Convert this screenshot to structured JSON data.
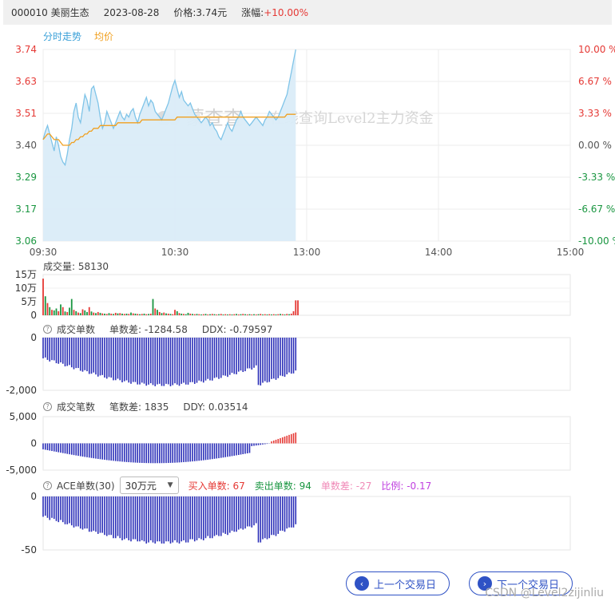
{
  "header": {
    "code": "000010 美丽生态",
    "date": "2023-08-28",
    "price": "价格:3.74元",
    "change_label": "涨幅:",
    "change_value": "+10.00%"
  },
  "colors": {
    "up": "#e53935",
    "down": "#1a9641",
    "price_line": "#7fc4e8",
    "area_fill": "#daecf8",
    "avg_line": "#f0a020",
    "bar_blue": "#2b2fb8",
    "legend_price": "#3aa0d8",
    "legend_avg": "#f0a020"
  },
  "watermark": {
    "brand": "蒙查查",
    "slogan": "在线查询Level2主力资金"
  },
  "chart_data": [
    {
      "type": "line",
      "legend": [
        "分时走势",
        "均价"
      ],
      "y_ticks_left": [
        "3.74",
        "3.63",
        "3.51",
        "3.40",
        "3.29",
        "3.17",
        "3.06"
      ],
      "y_ticks_right": [
        "10.00 %",
        "6.67 %",
        "3.33 %",
        "0.00 %",
        "-3.33 %",
        "-6.67 %",
        "-10.00 %"
      ],
      "x_ticks": [
        "09:30",
        "10:30",
        "13:00",
        "14:00",
        "15:00"
      ],
      "ylim": [
        3.06,
        3.74
      ],
      "prev_close": 3.4,
      "price": [
        3.42,
        3.45,
        3.47,
        3.44,
        3.41,
        3.38,
        3.43,
        3.4,
        3.36,
        3.34,
        3.33,
        3.37,
        3.42,
        3.46,
        3.52,
        3.55,
        3.5,
        3.48,
        3.53,
        3.58,
        3.56,
        3.52,
        3.6,
        3.61,
        3.58,
        3.55,
        3.5,
        3.46,
        3.48,
        3.52,
        3.5,
        3.48,
        3.46,
        3.48,
        3.5,
        3.52,
        3.5,
        3.49,
        3.51,
        3.5,
        3.52,
        3.53,
        3.5,
        3.48,
        3.51,
        3.53,
        3.55,
        3.57,
        3.54,
        3.56,
        3.55,
        3.52,
        3.51,
        3.5,
        3.49,
        3.51,
        3.53,
        3.55,
        3.58,
        3.61,
        3.63,
        3.6,
        3.57,
        3.59,
        3.56,
        3.55,
        3.54,
        3.55,
        3.53,
        3.51,
        3.5,
        3.49,
        3.48,
        3.49,
        3.5,
        3.49,
        3.47,
        3.48,
        3.46,
        3.45,
        3.43,
        3.42,
        3.44,
        3.46,
        3.48,
        3.46,
        3.45,
        3.47,
        3.49,
        3.5,
        3.52,
        3.5,
        3.49,
        3.48,
        3.47,
        3.48,
        3.49,
        3.5,
        3.49,
        3.48,
        3.47,
        3.49,
        3.5,
        3.52,
        3.51,
        3.5,
        3.49,
        3.5,
        3.52,
        3.54,
        3.56,
        3.58,
        3.62,
        3.66,
        3.7,
        3.74
      ],
      "avg": [
        3.42,
        3.43,
        3.44,
        3.44,
        3.43,
        3.42,
        3.42,
        3.42,
        3.41,
        3.4,
        3.4,
        3.4,
        3.4,
        3.41,
        3.41,
        3.42,
        3.42,
        3.43,
        3.43,
        3.44,
        3.44,
        3.45,
        3.45,
        3.46,
        3.46,
        3.46,
        3.47,
        3.47,
        3.47,
        3.47,
        3.47,
        3.47,
        3.47,
        3.47,
        3.48,
        3.48,
        3.48,
        3.48,
        3.48,
        3.48,
        3.48,
        3.48,
        3.48,
        3.48,
        3.48,
        3.49,
        3.49,
        3.49,
        3.49,
        3.49,
        3.49,
        3.49,
        3.49,
        3.49,
        3.49,
        3.49,
        3.49,
        3.49,
        3.49,
        3.49,
        3.49,
        3.5,
        3.5,
        3.5,
        3.5,
        3.5,
        3.5,
        3.5,
        3.5,
        3.5,
        3.5,
        3.5,
        3.5,
        3.5,
        3.5,
        3.5,
        3.5,
        3.5,
        3.5,
        3.5,
        3.5,
        3.5,
        3.5,
        3.5,
        3.5,
        3.5,
        3.5,
        3.5,
        3.5,
        3.5,
        3.5,
        3.5,
        3.5,
        3.5,
        3.5,
        3.5,
        3.5,
        3.5,
        3.5,
        3.5,
        3.5,
        3.5,
        3.5,
        3.5,
        3.5,
        3.5,
        3.5,
        3.5,
        3.5,
        3.5,
        3.5,
        3.51,
        3.51,
        3.51,
        3.51,
        3.51
      ],
      "total_points": 241
    },
    {
      "type": "bar",
      "title": "成交量: 58130",
      "y_ticks": [
        "15万",
        "10万",
        "5万",
        "0"
      ],
      "ylim": [
        0,
        150000
      ],
      "values": [
        135000,
        70000,
        45000,
        30000,
        20000,
        18000,
        25000,
        15000,
        40000,
        30000,
        14000,
        12000,
        28000,
        60000,
        20000,
        15000,
        10000,
        8000,
        22000,
        18000,
        12000,
        30000,
        14000,
        10000,
        8000,
        12000,
        9000,
        7000,
        6000,
        5000,
        8000,
        6000,
        5000,
        9000,
        7000,
        8000,
        6000,
        5000,
        6000,
        5000,
        10000,
        7000,
        6000,
        5000,
        4000,
        5000,
        6000,
        4000,
        5000,
        6000,
        60000,
        25000,
        20000,
        12000,
        8000,
        10000,
        7000,
        6000,
        5000,
        4000,
        20000,
        15000,
        8000,
        6000,
        5000,
        4000,
        9000,
        6000,
        5000,
        4000,
        5000,
        4000,
        3000,
        4000,
        5000,
        3000,
        4000,
        5000,
        4000,
        3000,
        4000,
        5000,
        3000,
        4000,
        3000,
        4000,
        3000,
        4000,
        5000,
        3000,
        4000,
        5000,
        4000,
        3000,
        4000,
        3000,
        4000,
        3000,
        4000,
        5000,
        3000,
        4000,
        3000,
        4000,
        3000,
        4000,
        3000,
        4000,
        5000,
        4000,
        3000,
        5000,
        4000,
        6000,
        15000,
        55000,
        55000
      ],
      "up_flags": [
        1,
        0,
        1,
        0,
        1,
        0,
        0,
        1,
        0,
        1,
        0,
        1,
        0,
        0,
        1,
        0,
        1,
        0,
        1,
        0,
        0,
        1,
        0,
        1,
        0,
        1,
        0,
        1,
        0,
        1,
        0,
        1,
        0,
        1,
        0,
        1,
        0,
        1,
        0,
        1,
        0,
        1,
        0,
        1,
        0,
        1,
        0,
        1,
        0,
        1,
        0,
        1,
        0,
        1,
        0,
        1,
        0,
        1,
        0,
        1,
        1,
        0,
        1,
        0,
        1,
        0,
        0,
        1,
        0,
        1,
        0,
        1,
        0,
        1,
        0,
        1,
        0,
        1,
        0,
        1,
        0,
        1,
        0,
        1,
        0,
        1,
        0,
        1,
        0,
        1,
        0,
        1,
        0,
        1,
        0,
        1,
        0,
        1,
        0,
        1,
        0,
        1,
        0,
        1,
        0,
        1,
        0,
        1,
        0,
        1,
        0,
        1,
        0,
        1,
        1,
        1,
        1
      ]
    },
    {
      "type": "bar",
      "title": "成交单数",
      "stat1": "单数差:  -1284.58",
      "stat2": "DDX:  -0.79597",
      "y_ticks": [
        "0",
        "-2,000"
      ],
      "ylim": [
        -2000,
        0
      ],
      "shape": "dip",
      "min_value": -1800,
      "end_value": -1284.58
    },
    {
      "type": "bar",
      "title": "成交笔数",
      "stat1": "笔数差:  1835",
      "stat2": "DDY:  0.03514",
      "y_ticks": [
        "5,000",
        "0",
        "-5,000"
      ],
      "ylim": [
        -5000,
        5000
      ],
      "shape": "dip_then_up",
      "min_value": -3700,
      "end_value": 1835
    },
    {
      "type": "bar",
      "title": "ACE单数(30)",
      "select": "30万元",
      "buy": "买入单数:  67",
      "sell": "卖出单数:  94",
      "diff": "单数差:  -27",
      "ratio": "比例:  -0.17",
      "y_ticks": [
        "0",
        "-50"
      ],
      "ylim": [
        -50,
        0
      ],
      "shape": "dip",
      "min_value": -43,
      "end_value": -27
    }
  ],
  "buttons": {
    "prev": "上一个交易日",
    "next": "下一个交易日"
  },
  "credit": "CSDN @Level2zijinliu"
}
